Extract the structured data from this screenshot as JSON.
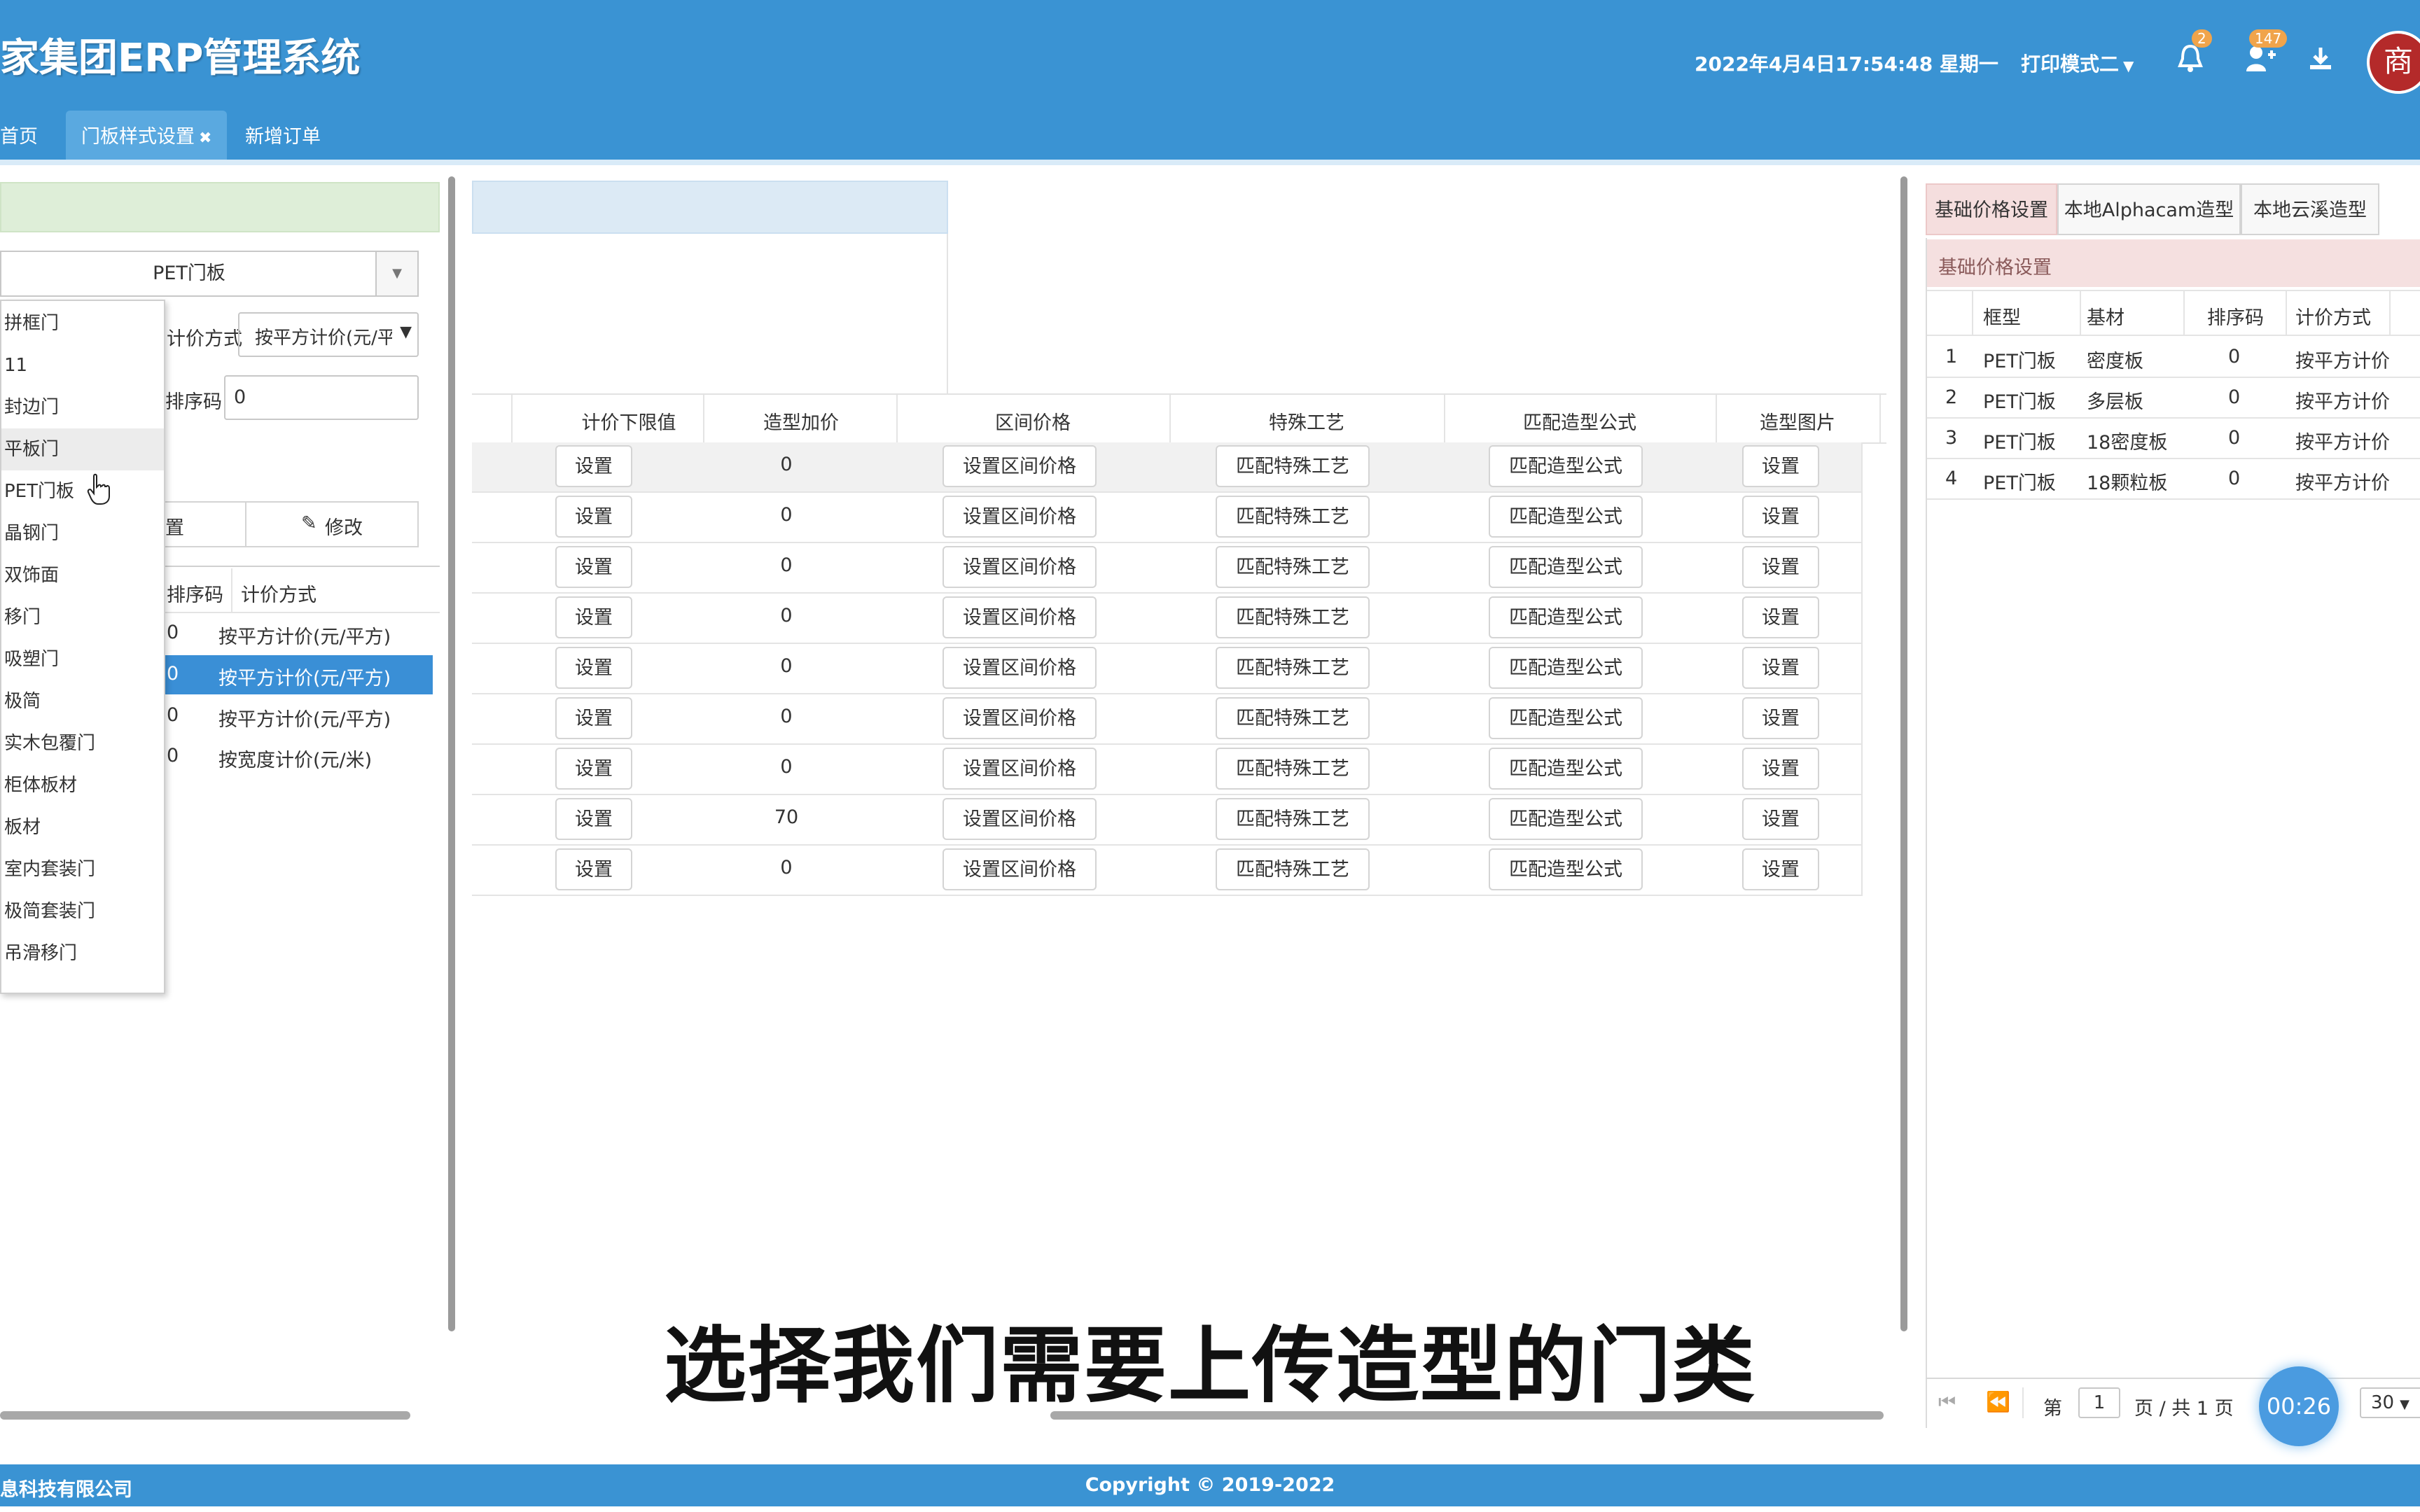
{
  "header": {
    "app_title": "家集团ERP管理系统",
    "datetime": "2022年4月4日17:54:48 星期一",
    "print_mode": "打印模式二",
    "notif_count": "2",
    "user_count": "147",
    "avatar_glyph": "商"
  },
  "tabs": [
    {
      "label": "首页"
    },
    {
      "label": "门板样式设置",
      "close": "✖"
    },
    {
      "label": "新增订单"
    }
  ],
  "left_panel": {
    "selected_type": "PET门板",
    "pricing_method_label": "计价方式",
    "pricing_method_value": "按平方计价(元/平方)",
    "sort_code_label": "排序码",
    "sort_code_value": "0",
    "btn_set": "置",
    "btn_edit": "修改",
    "grid_headers": [
      "排序码",
      "计价方式"
    ],
    "grid_rows": [
      {
        "sort": "0",
        "method": "按平方计价(元/平方)"
      },
      {
        "sort": "0",
        "method": "按平方计价(元/平方)"
      },
      {
        "sort": "0",
        "method": "按平方计价(元/平方)"
      },
      {
        "sort": "0",
        "method": "按宽度计价(元/米)"
      }
    ],
    "dropdown_items": [
      "拼框门",
      "11",
      "封边门",
      "平板门",
      "PET门板",
      "晶钢门",
      "双饰面",
      "移门",
      "吸塑门",
      "极简",
      "实木包覆门",
      "柜体板材",
      "板材",
      "室内套装门",
      "极简套装门",
      "吊滑移门"
    ]
  },
  "middle_panel": {
    "headers": [
      "计价下限值",
      "造型加价",
      "区间价格",
      "特殊工艺",
      "匹配造型公式",
      "造型图片"
    ],
    "rows": [
      {
        "min": "设置",
        "add": "0",
        "range": "设置区间价格",
        "craft": "匹配特殊工艺",
        "formula": "匹配造型公式",
        "image": "设置"
      },
      {
        "min": "设置",
        "add": "0",
        "range": "设置区间价格",
        "craft": "匹配特殊工艺",
        "formula": "匹配造型公式",
        "image": "设置"
      },
      {
        "min": "设置",
        "add": "0",
        "range": "设置区间价格",
        "craft": "匹配特殊工艺",
        "formula": "匹配造型公式",
        "image": "设置"
      },
      {
        "min": "设置",
        "add": "0",
        "range": "设置区间价格",
        "craft": "匹配特殊工艺",
        "formula": "匹配造型公式",
        "image": "设置"
      },
      {
        "min": "设置",
        "add": "0",
        "range": "设置区间价格",
        "craft": "匹配特殊工艺",
        "formula": "匹配造型公式",
        "image": "设置"
      },
      {
        "min": "设置",
        "add": "0",
        "range": "设置区间价格",
        "craft": "匹配特殊工艺",
        "formula": "匹配造型公式",
        "image": "设置"
      },
      {
        "min": "设置",
        "add": "0",
        "range": "设置区间价格",
        "craft": "匹配特殊工艺",
        "formula": "匹配造型公式",
        "image": "设置"
      },
      {
        "min": "设置",
        "add": "70",
        "range": "设置区间价格",
        "craft": "匹配特殊工艺",
        "formula": "匹配造型公式",
        "image": "设置"
      },
      {
        "min": "设置",
        "add": "0",
        "range": "设置区间价格",
        "craft": "匹配特殊工艺",
        "formula": "匹配造型公式",
        "image": "设置"
      }
    ]
  },
  "right_panel": {
    "tabs": [
      "基础价格设置",
      "本地Alphacam造型",
      "本地云溪造型"
    ],
    "section_title": "基础价格设置",
    "headers": [
      "框型",
      "基材",
      "排序码",
      "计价方式"
    ],
    "rows": [
      {
        "no": "1",
        "frame": "PET门板",
        "base": "密度板",
        "sort": "0",
        "method": "按平方计价"
      },
      {
        "no": "2",
        "frame": "PET门板",
        "base": "多层板",
        "sort": "0",
        "method": "按平方计价"
      },
      {
        "no": "3",
        "frame": "PET门板",
        "base": "18密度板",
        "sort": "0",
        "method": "按平方计价"
      },
      {
        "no": "4",
        "frame": "PET门板",
        "base": "18颗粒板",
        "sort": "0",
        "method": "按平方计价"
      }
    ],
    "pager": {
      "page_prefix": "第",
      "page": "1",
      "page_suffix": "页 / 共 1 页",
      "page_size": "30"
    }
  },
  "caption": "选择我们需要上传造型的门类",
  "timer": "00:26",
  "footer": {
    "company": "息科技有限公司",
    "copyright": "Copyright © 2019-2022"
  },
  "colors": {
    "header_blue": "#3a93d3",
    "selected_row": "#3a8fd6",
    "badge_orange": "#f0a44b"
  }
}
